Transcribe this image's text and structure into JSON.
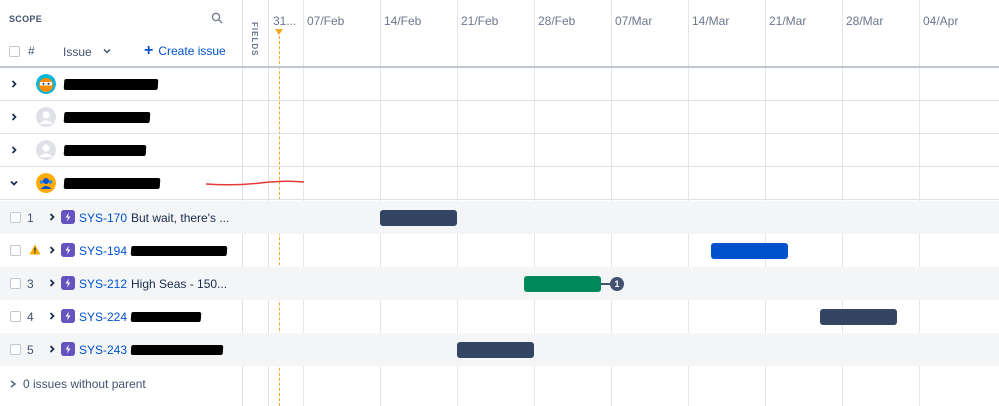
{
  "scope_header": {
    "title": "SCOPE",
    "hash": "#",
    "issue_label": "Issue",
    "create_label": "Create issue"
  },
  "fields_label": "FIELDS",
  "timeline": {
    "labels": [
      "31...",
      "07/Feb",
      "14/Feb",
      "21/Feb",
      "28/Feb",
      "07/Mar",
      "14/Mar",
      "21/Mar",
      "28/Mar",
      "04/Apr"
    ]
  },
  "parents": [
    {
      "avatar": "orange-ninja-avatar",
      "expanded": false
    },
    {
      "avatar": "default-avatar",
      "expanded": false
    },
    {
      "avatar": "default-avatar",
      "expanded": false
    },
    {
      "avatar": "team-avatar",
      "expanded": true
    }
  ],
  "children": [
    {
      "num": "1",
      "key": "SYS-170",
      "summary": "But wait, there's ...",
      "bar_color": "#344563",
      "warning": false,
      "dependency": ""
    },
    {
      "num": "",
      "key": "SYS-194",
      "summary": "",
      "bar_color": "#0052cc",
      "warning": true,
      "dependency": ""
    },
    {
      "num": "3",
      "key": "SYS-212",
      "summary": "High Seas - 150...",
      "bar_color": "#00875a",
      "warning": false,
      "dependency": "1"
    },
    {
      "num": "4",
      "key": "SYS-224",
      "summary": "",
      "bar_color": "#344563",
      "warning": false,
      "dependency": ""
    },
    {
      "num": "5",
      "key": "SYS-243",
      "summary": "",
      "bar_color": "#344563",
      "warning": false,
      "dependency": ""
    }
  ],
  "without_parent_label": "0 issues without parent",
  "colors": {
    "link": "#0052cc",
    "epic": "#6554c0",
    "today": "#f5a623",
    "annotation": "#e53935"
  }
}
